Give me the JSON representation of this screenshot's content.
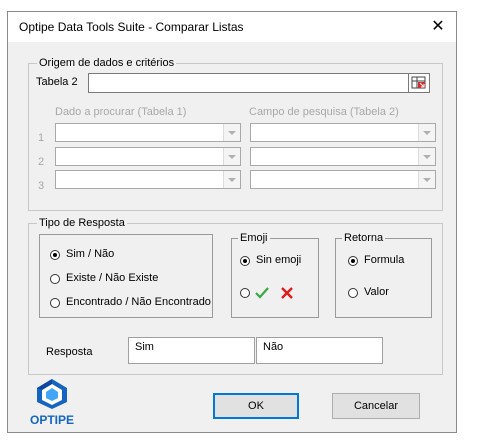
{
  "window": {
    "title": "Optipe Data Tools Suite - Comparar Listas",
    "close_glyph": "✕"
  },
  "origem": {
    "legend": "Origem de dados e critérios",
    "tabela2_label": "Tabela 2",
    "tabela2_value": "",
    "ref_icon": "range-select-icon",
    "col1_header": "Dado a procurar (Tabela 1)",
    "col2_header": "Campo de pesquisa (Tabela 2)",
    "rows": [
      "1",
      "2",
      "3"
    ]
  },
  "tipo": {
    "legend": "Tipo de Resposta",
    "options": [
      "Sim / Não",
      "Existe / Não Existe",
      "Encontrado / Não Encontrado"
    ],
    "selected": 0,
    "resposta_label": "Resposta",
    "resposta_sim": "Sim",
    "resposta_nao": "Não"
  },
  "emoji": {
    "legend": "Emoji",
    "option_sem": "Sin emoji",
    "check_icon": "check-icon",
    "cross_icon": "cross-icon",
    "check_color": "#3aa845",
    "cross_color": "#e01b1b"
  },
  "retorna": {
    "legend": "Retorna",
    "option_formula": "Formula",
    "option_valor": "Valor"
  },
  "buttons": {
    "ok": "OK",
    "cancel": "Cancelar"
  },
  "logo": {
    "text": "OPTIPE",
    "color": "#1565c0"
  }
}
